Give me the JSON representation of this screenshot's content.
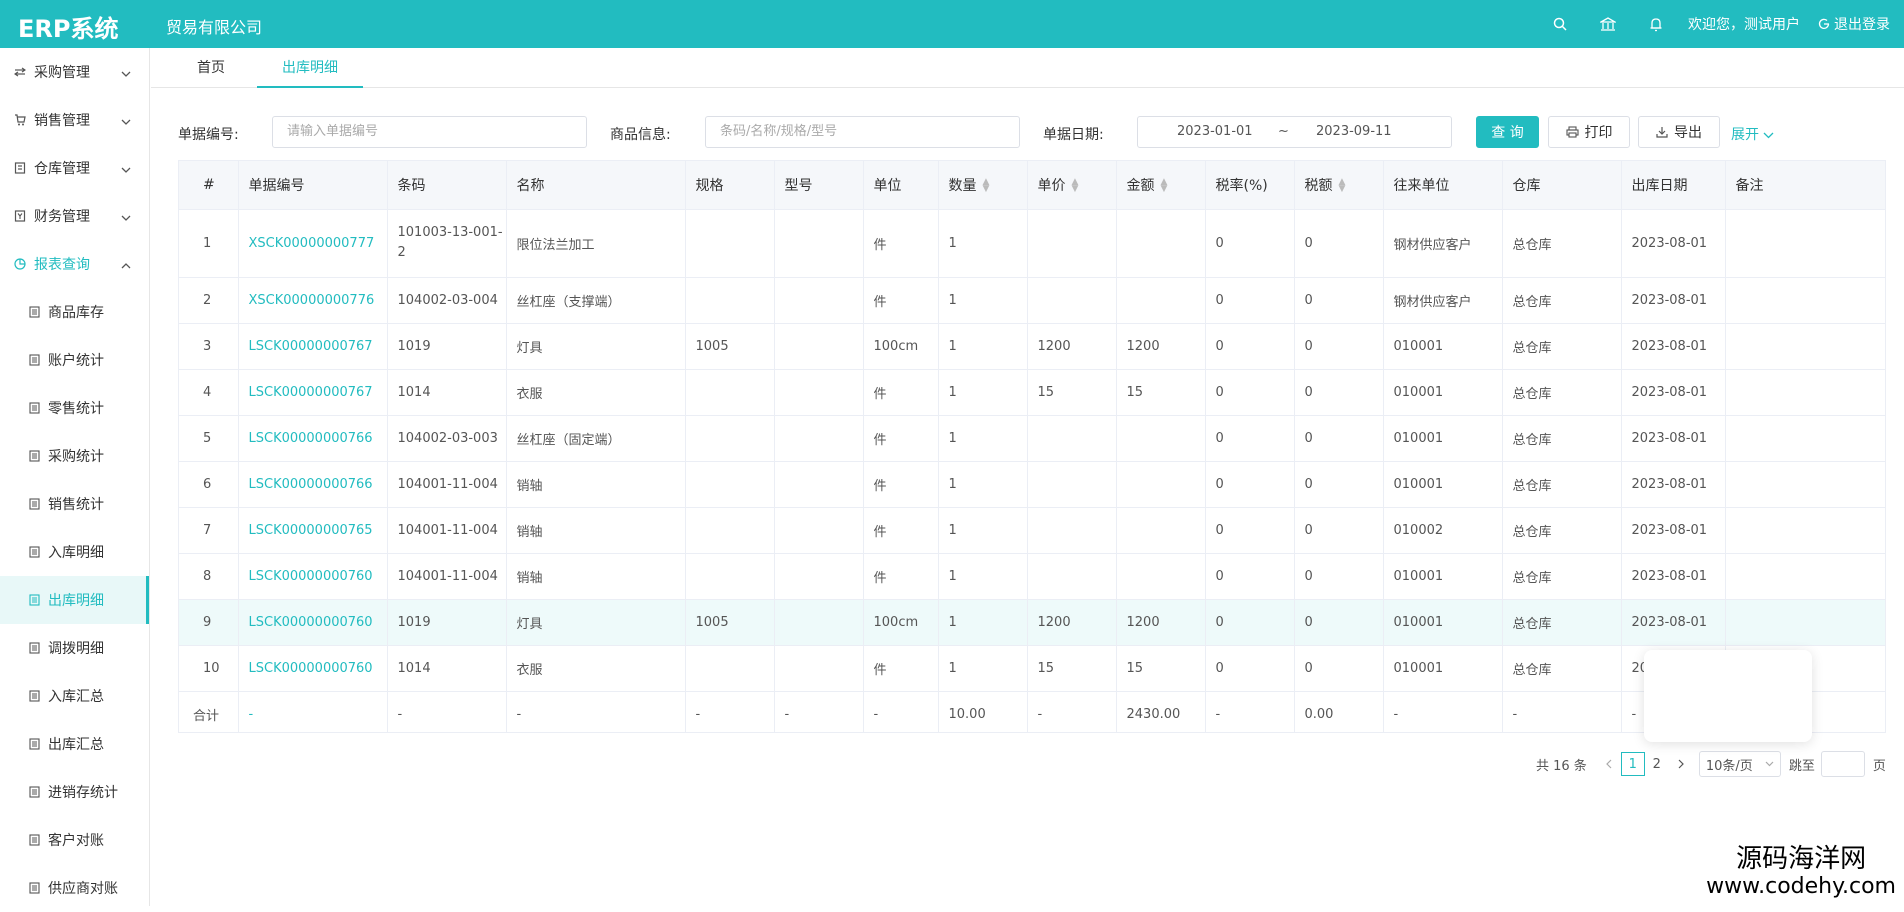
{
  "header": {
    "logo": "ERP系统",
    "company": "贸易有限公司",
    "welcome": "欢迎您，测试用户",
    "logout": "退出登录",
    "icons": [
      "search-icon",
      "home-icon",
      "bell-icon"
    ],
    "color": "#22bcc0"
  },
  "sidebar": {
    "menus": [
      {
        "label": "采购管理",
        "icon": "transfer-icon"
      },
      {
        "label": "销售管理",
        "icon": "cart-icon"
      },
      {
        "label": "仓库管理",
        "icon": "warehouse-icon"
      },
      {
        "label": "财务管理",
        "icon": "finance-icon"
      },
      {
        "label": "报表查询",
        "icon": "chart-icon"
      }
    ],
    "sub": [
      "商品库存",
      "账户统计",
      "零售统计",
      "采购统计",
      "销售统计",
      "入库明细",
      "出库明细",
      "调拨明细",
      "入库汇总",
      "出库汇总",
      "进销存统计",
      "客户对账",
      "供应商对账"
    ],
    "active": "出库明细"
  },
  "tabs": [
    "首页",
    "出库明细"
  ],
  "filters": {
    "doc_label": "单据编号:",
    "doc_placeholder": "请输入单据编号",
    "goods_label": "商品信息:",
    "goods_placeholder": "条码/名称/规格/型号",
    "date_label": "单据日期:",
    "date_from": "2023-01-01",
    "date_sep": "~",
    "date_to": "2023-09-11",
    "query_btn": "查 询",
    "print_btn": "打印",
    "export_btn": "导出",
    "expand": "展开"
  },
  "table": {
    "columns": [
      "#",
      "单据编号",
      "条码",
      "名称",
      "规格",
      "型号",
      "单位",
      "数量",
      "单价",
      "金额",
      "税率(%)",
      "税额",
      "往来单位",
      "仓库",
      "出库日期",
      "备注"
    ],
    "rows": [
      [
        "1",
        "XSCK00000000777",
        "101003-13-001-2",
        "限位法兰加工",
        "",
        "",
        "件",
        "1",
        "",
        "",
        "0",
        "0",
        "钢材供应客户",
        "总仓库",
        "2023-08-01",
        ""
      ],
      [
        "2",
        "XSCK00000000776",
        "104002-03-004",
        "丝杠座（支撑端）",
        "",
        "",
        "件",
        "1",
        "",
        "",
        "0",
        "0",
        "钢材供应客户",
        "总仓库",
        "2023-08-01",
        ""
      ],
      [
        "3",
        "LSCK00000000767",
        "1019",
        "灯具",
        "1005",
        "",
        "100cm",
        "1",
        "1200",
        "1200",
        "0",
        "0",
        "010001",
        "总仓库",
        "2023-08-01",
        ""
      ],
      [
        "4",
        "LSCK00000000767",
        "1014",
        "衣服",
        "",
        "",
        "件",
        "1",
        "15",
        "15",
        "0",
        "0",
        "010001",
        "总仓库",
        "2023-08-01",
        ""
      ],
      [
        "5",
        "LSCK00000000766",
        "104002-03-003",
        "丝杠座（固定端）",
        "",
        "",
        "件",
        "1",
        "",
        "",
        "0",
        "0",
        "010001",
        "总仓库",
        "2023-08-01",
        ""
      ],
      [
        "6",
        "LSCK00000000766",
        "104001-11-004",
        "销轴",
        "",
        "",
        "件",
        "1",
        "",
        "",
        "0",
        "0",
        "010001",
        "总仓库",
        "2023-08-01",
        ""
      ],
      [
        "7",
        "LSCK00000000765",
        "104001-11-004",
        "销轴",
        "",
        "",
        "件",
        "1",
        "",
        "",
        "0",
        "0",
        "010002",
        "总仓库",
        "2023-08-01",
        ""
      ],
      [
        "8",
        "LSCK00000000760",
        "104001-11-004",
        "销轴",
        "",
        "",
        "件",
        "1",
        "",
        "",
        "0",
        "0",
        "010001",
        "总仓库",
        "2023-08-01",
        ""
      ],
      [
        "9",
        "LSCK00000000760",
        "1019",
        "灯具",
        "1005",
        "",
        "100cm",
        "1",
        "1200",
        "1200",
        "0",
        "0",
        "010001",
        "总仓库",
        "2023-08-01",
        ""
      ],
      [
        "10",
        "LSCK00000000760",
        "1014",
        "衣服",
        "",
        "",
        "件",
        "1",
        "15",
        "15",
        "0",
        "0",
        "010001",
        "总仓库",
        "20",
        ""
      ]
    ],
    "summary": [
      "合计",
      "-",
      "-",
      "-",
      "-",
      "-",
      "-",
      "10.00",
      "-",
      "2430.00",
      "-",
      "0.00",
      "-",
      "-",
      "-",
      ""
    ]
  },
  "pager": {
    "total": "共 16 条",
    "pages": [
      "1",
      "2"
    ],
    "current": "1",
    "size": "10条/页",
    "jump_label": "跳至",
    "page_label": "页"
  },
  "watermark": {
    "cn": "源码海洋网",
    "url": "www.codehy.com"
  }
}
